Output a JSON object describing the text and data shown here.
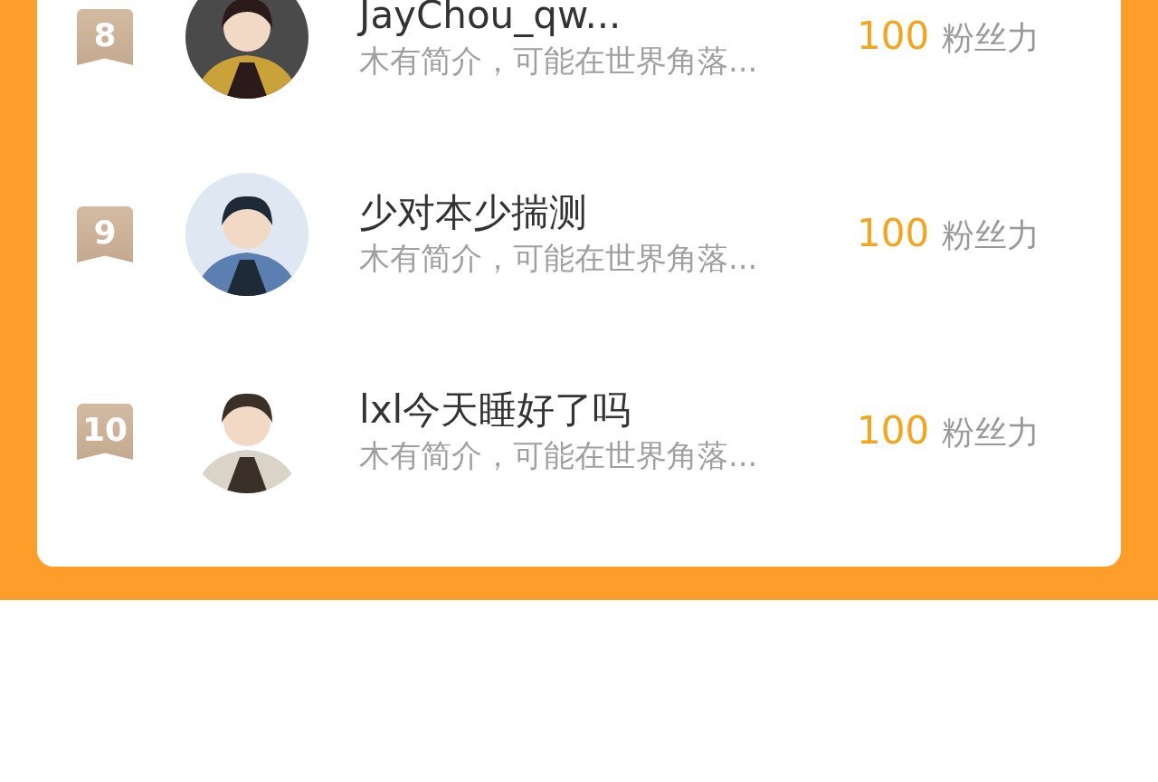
{
  "ranking": [
    {
      "rank": "8",
      "name": "JayChou_qw...",
      "intro": "木有简介，可能在世界角落...",
      "score": "100",
      "score_unit": "粉丝力"
    },
    {
      "rank": "9",
      "name": "少对本少揣测",
      "intro": "木有简介，可能在世界角落...",
      "score": "100",
      "score_unit": "粉丝力"
    },
    {
      "rank": "10",
      "name": "lxl今天睡好了吗",
      "intro": "木有简介，可能在世界角落...",
      "score": "100",
      "score_unit": "粉丝力"
    }
  ]
}
